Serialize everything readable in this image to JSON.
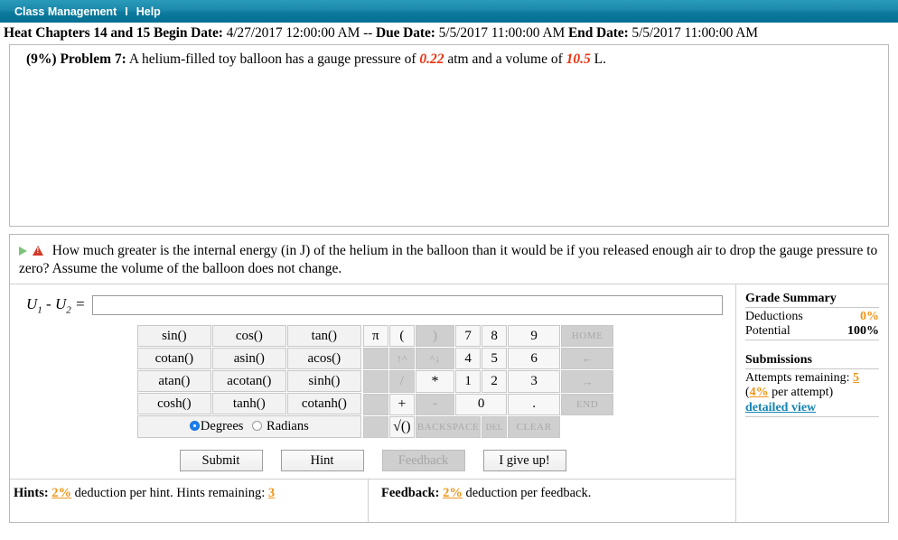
{
  "nav": {
    "items": [
      {
        "label": "Class Management",
        "name": "nav-class-management"
      },
      {
        "label": "Help",
        "name": "nav-help"
      }
    ],
    "separator": "I",
    "bg_color": "#0d7b9e"
  },
  "assignment": {
    "title": "Heat Chapters 14 and 15",
    "begin_label": "Begin Date:",
    "begin_value": "4/27/2017 12:00:00 AM",
    "dash": "--",
    "due_label": "Due Date:",
    "due_value": "5/5/2017 11:00:00 AM",
    "end_label": "End Date:",
    "end_value": "5/5/2017 11:00:00 AM"
  },
  "problem": {
    "weight": "(9%)",
    "number_label": "Problem 7:",
    "text_before": "A helium-filled toy balloon has a gauge pressure of",
    "pressure_value": "0.22",
    "text_middle": "atm and a volume of",
    "volume_value": "10.5",
    "text_after": "L."
  },
  "question": {
    "play_icon": "play-icon",
    "warning_icon": "warning-icon",
    "text": "How much greater is the internal energy (in J) of the helium in the balloon than it would be if you released enough air to drop the gauge pressure to zero? Assume the volume of the balloon does not change."
  },
  "answer": {
    "label_u1": "U",
    "label_sub1": "1",
    "label_minus": "-",
    "label_u2": "U",
    "label_sub2": "2",
    "label_equals": "=",
    "value": "",
    "placeholder": ""
  },
  "calculator": {
    "function_rows": [
      [
        "sin()",
        "cos()",
        "tan()"
      ],
      [
        "cotan()",
        "asin()",
        "acos()"
      ],
      [
        "atan()",
        "acotan()",
        "sinh()"
      ],
      [
        "cosh()",
        "tanh()",
        "cotanh()"
      ]
    ],
    "modes": {
      "degrees_label": "Degrees",
      "radians_label": "Radians",
      "selected": "Degrees"
    },
    "numpad_rows": [
      [
        {
          "label": "π",
          "state": "key",
          "name": "calc-pi"
        },
        {
          "label": "(",
          "state": "key",
          "name": "calc-open-paren"
        },
        {
          "label": ")",
          "state": "dim",
          "name": "calc-close-paren"
        },
        {
          "label": "7",
          "state": "key",
          "name": "calc-7"
        },
        {
          "label": "8",
          "state": "key",
          "name": "calc-8"
        },
        {
          "label": "9",
          "state": "key",
          "name": "calc-9"
        },
        {
          "label": "HOME",
          "state": "nav",
          "name": "calc-home"
        }
      ],
      [
        {
          "label": "",
          "state": "blank",
          "name": "calc-blank-1"
        },
        {
          "label": "↑^",
          "state": "arrowdim",
          "name": "calc-superscript"
        },
        {
          "label": "^↓",
          "state": "arrowdim",
          "name": "calc-subscript"
        },
        {
          "label": "4",
          "state": "key",
          "name": "calc-4"
        },
        {
          "label": "5",
          "state": "key",
          "name": "calc-5"
        },
        {
          "label": "6",
          "state": "key",
          "name": "calc-6"
        },
        {
          "label": "←",
          "state": "navarrow",
          "name": "calc-left-arrow"
        }
      ],
      [
        {
          "label": "",
          "state": "blank",
          "name": "calc-blank-2"
        },
        {
          "label": "/",
          "state": "opdim",
          "name": "calc-divide"
        },
        {
          "label": "*",
          "state": "op",
          "name": "calc-multiply"
        },
        {
          "label": "1",
          "state": "key",
          "name": "calc-1"
        },
        {
          "label": "2",
          "state": "key",
          "name": "calc-2"
        },
        {
          "label": "3",
          "state": "key",
          "name": "calc-3"
        },
        {
          "label": "→",
          "state": "navarrow",
          "name": "calc-right-arrow"
        }
      ],
      [
        {
          "label": "",
          "state": "blank",
          "name": "calc-blank-3"
        },
        {
          "label": "+",
          "state": "op",
          "name": "calc-plus"
        },
        {
          "label": "-",
          "state": "opdim",
          "name": "calc-minus"
        },
        {
          "label": "0",
          "state": "key-wide",
          "name": "calc-0"
        },
        {
          "label": ".",
          "state": "key",
          "name": "calc-decimal"
        },
        {
          "label": "END",
          "state": "nav",
          "name": "calc-end"
        }
      ],
      [
        {
          "label": "",
          "state": "blank",
          "name": "calc-blank-4"
        },
        {
          "label": "√()",
          "state": "sqrt",
          "name": "calc-sqrt"
        },
        {
          "label": "BACKSPACE",
          "state": "wide",
          "name": "calc-backspace"
        },
        {
          "label": "DEL",
          "state": "del",
          "name": "calc-del"
        },
        {
          "label": "CLEAR",
          "state": "nav",
          "name": "calc-clear"
        }
      ]
    ]
  },
  "actions": [
    {
      "label": "Submit",
      "name": "submit-button",
      "disabled": false
    },
    {
      "label": "Hint",
      "name": "hint-button",
      "disabled": false
    },
    {
      "label": "Feedback",
      "name": "feedback-button",
      "disabled": true
    },
    {
      "label": "I give up!",
      "name": "give-up-button",
      "disabled": false
    }
  ],
  "hints": {
    "label": "Hints:",
    "deduction": "2%",
    "text_mid": "deduction per hint. Hints remaining:",
    "remaining": "3"
  },
  "feedback": {
    "label": "Feedback:",
    "deduction": "2%",
    "text_mid": "deduction per feedback."
  },
  "grade_summary": {
    "title": "Grade Summary",
    "deductions_label": "Deductions",
    "deductions_value": "0%",
    "potential_label": "Potential",
    "potential_value": "100%",
    "submissions_title": "Submissions",
    "attempts_label": "Attempts remaining:",
    "attempts_value": "5",
    "per_attempt_open": "(",
    "per_attempt_pct": "4%",
    "per_attempt_close": " per attempt)",
    "detailed_view": "detailed view"
  },
  "colors": {
    "nav_teal": "#0d7b9e",
    "accent_orange": "#f0951a",
    "link_blue": "#1585b5",
    "value_red": "#ee3311"
  }
}
